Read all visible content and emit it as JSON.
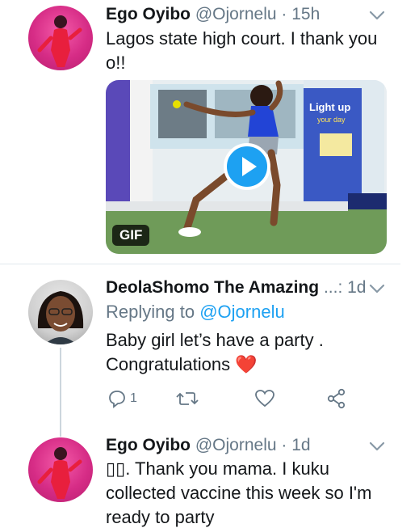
{
  "tweets": [
    {
      "author_name": "Ego Oyibo",
      "handle": "@Ojornelu",
      "separator": "·",
      "time": "15h",
      "text_line1": "Lagos state high court. I thank you",
      "text_line2": "o!!",
      "media_badge": "GIF",
      "avatar_icon": "profile-photo"
    },
    {
      "author_name": "DeolaShomo The Amazing",
      "author_ellipsis": "...:",
      "time": "1d",
      "replying_prefix": "Replying to",
      "replying_handle": "@Ojornelu",
      "text_line1": "Baby girl let’s have a party .",
      "text_line2": "Congratulations ❤️",
      "reply_count": "1",
      "avatar_icon": "profile-photo"
    },
    {
      "author_name": "Ego Oyibo",
      "handle": "@Ojornelu",
      "separator": "·",
      "time": "1d",
      "text_line1": "▯▯. Thank you mama. I kuku",
      "text_line2": "collected vaccine this week so I'm",
      "text_line3": "ready to party",
      "avatar_icon": "profile-photo"
    }
  ],
  "colors": {
    "accent": "#1da1f2",
    "muted": "#657786",
    "heart": "#e0245e"
  }
}
